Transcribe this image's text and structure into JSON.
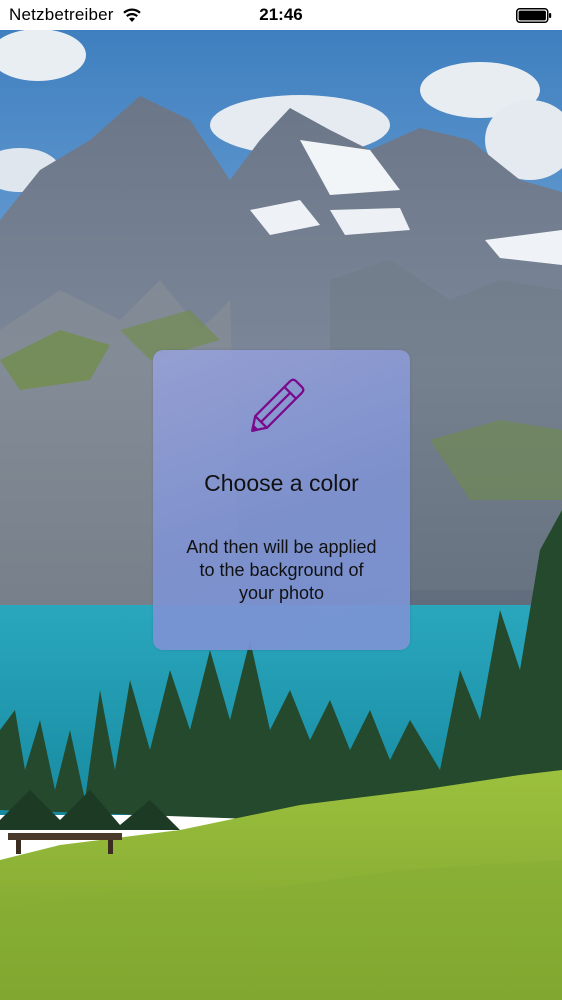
{
  "status_bar": {
    "carrier": "Netzbetreiber",
    "time": "21:46"
  },
  "card": {
    "icon": "pencil-icon",
    "icon_color": "#7a0a8c",
    "title": "Choose a color",
    "description": "And then will be applied to the background of your photo"
  },
  "background": {
    "sky": "#4a86c0",
    "lake": "#1f9db2",
    "meadow": "#8fb63a"
  }
}
